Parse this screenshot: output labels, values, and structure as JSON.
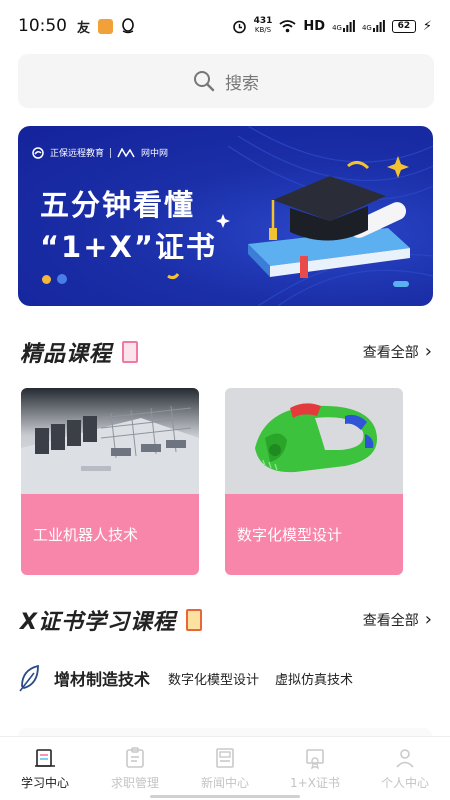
{
  "status_bar": {
    "time": "10:50",
    "net_speed": "431",
    "net_speed_unit": "KB/S",
    "hd": "HD",
    "sim1": "4G",
    "sim2": "4G",
    "battery": "62"
  },
  "search": {
    "placeholder": "搜索"
  },
  "banner": {
    "logo_left": "正保远程教育",
    "logo_right": "网中网",
    "line1": "五分钟看懂",
    "line2": "“1+X”证书"
  },
  "featured": {
    "title": "精品课程",
    "see_all": "查看全部",
    "courses": [
      {
        "label": "工业机器人技术",
        "thumb": "factory-image"
      },
      {
        "label": "数字化模型设计",
        "thumb": "3d-model-image"
      }
    ]
  },
  "x_courses": {
    "title": "X证书学习课程",
    "see_all": "查看全部",
    "tabs": [
      "增材制造技术",
      "数字化模型设计",
      "虚拟仿真技术"
    ],
    "active_tab": 0
  },
  "bottom_nav": {
    "items": [
      {
        "label": "学习中心",
        "icon": "study-center-icon",
        "active": true
      },
      {
        "label": "求职管理",
        "icon": "job-icon",
        "active": false
      },
      {
        "label": "新闻中心",
        "icon": "news-icon",
        "active": false
      },
      {
        "label": "1+X证书",
        "icon": "certificate-icon",
        "active": false
      },
      {
        "label": "个人中心",
        "icon": "profile-icon",
        "active": false
      }
    ]
  },
  "colors": {
    "accent_pink": "#f786aa",
    "tab_highlight": "#5bc6f0",
    "banner_blue": "#1b2fa8"
  }
}
